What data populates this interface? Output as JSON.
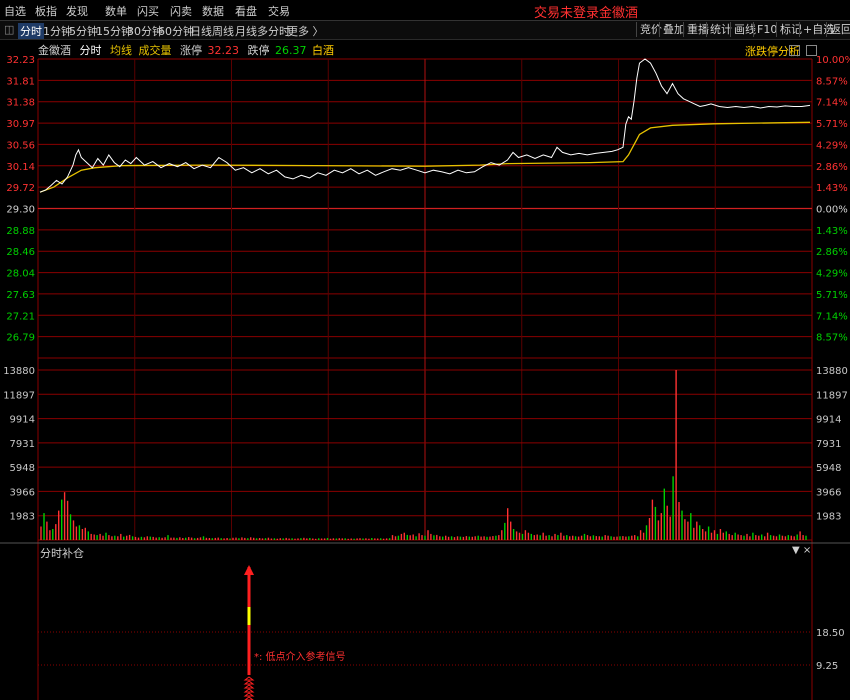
{
  "menu": {
    "items": [
      "自选",
      "板指",
      "发现",
      "数单",
      "闪买",
      "闪卖",
      "数据",
      "看盘",
      "交易"
    ],
    "center_status": "交易未登录",
    "center_stock": "金徽酒"
  },
  "toolbar": {
    "periods": [
      "分时",
      "1分钟",
      "5分钟",
      "15分钟",
      "30分钟",
      "60分钟",
      "日线",
      "周线",
      "月线",
      "多分时",
      "更多 〉"
    ],
    "active": "分时",
    "right_buttons": [
      "竞价",
      "叠加",
      "重播",
      "统计",
      "画线",
      "F10",
      "标记",
      "+自选",
      "返回"
    ]
  },
  "chart_header": {
    "stock": "金徽酒",
    "mode": "分时",
    "avg_label": "均线",
    "vol_label": "成交量",
    "limit_up_label": "涨停",
    "limit_up_value": "32.23",
    "limit_down_label": "跌停",
    "limit_down_value": "26.37",
    "theme_label": "白酒",
    "analysis_link": "涨跌停分析"
  },
  "price_axis": {
    "left": [
      "32.23",
      "31.81",
      "31.38",
      "30.97",
      "30.56",
      "30.14",
      "29.72",
      "29.30",
      "28.88",
      "28.46",
      "28.04",
      "27.63",
      "27.21",
      "26.79"
    ],
    "right": [
      "10.00%",
      "8.57%",
      "7.14%",
      "5.71%",
      "4.29%",
      "2.86%",
      "1.43%",
      "0.00%",
      "1.43%",
      "2.86%",
      "4.29%",
      "5.71%",
      "7.14%",
      "8.57%"
    ]
  },
  "volume_axis": [
    "13880",
    "11897",
    "9914",
    "7931",
    "5948",
    "3966",
    "1983"
  ],
  "sub_panel": {
    "title": "分时补仓",
    "controls": "▼  ×",
    "y_labels": [
      "18.50",
      "9.25"
    ],
    "signal_text": "*: 低点介入参考信号"
  },
  "colors": {
    "up": "#ff3232",
    "down": "#00d000",
    "grid": "#8a0000",
    "price_line": "#ffffff",
    "avg_line": "#e6c200",
    "signal_yellow": "#ffff00"
  },
  "chart_data": {
    "type": "line",
    "prev_close": 29.3,
    "ylim": [
      26.37,
      32.23
    ],
    "minutes": 240,
    "price_series_name": "分时",
    "avg_series_name": "均线",
    "price": [
      [
        0,
        29.62
      ],
      [
        2,
        29.66
      ],
      [
        4,
        29.75
      ],
      [
        6,
        29.85
      ],
      [
        8,
        29.78
      ],
      [
        10,
        29.92
      ],
      [
        12,
        30.15
      ],
      [
        13,
        30.35
      ],
      [
        14,
        30.45
      ],
      [
        15,
        30.3
      ],
      [
        17,
        30.2
      ],
      [
        19,
        30.1
      ],
      [
        21,
        30.28
      ],
      [
        23,
        30.15
      ],
      [
        25,
        30.35
      ],
      [
        27,
        30.2
      ],
      [
        29,
        30.12
      ],
      [
        31,
        30.25
      ],
      [
        33,
        30.18
      ],
      [
        35,
        30.3
      ],
      [
        38,
        30.15
      ],
      [
        41,
        30.22
      ],
      [
        44,
        30.1
      ],
      [
        47,
        30.18
      ],
      [
        50,
        30.12
      ],
      [
        53,
        30.2
      ],
      [
        56,
        30.08
      ],
      [
        59,
        30.15
      ],
      [
        62,
        30.1
      ],
      [
        65,
        30.3
      ],
      [
        68,
        30.2
      ],
      [
        71,
        30.05
      ],
      [
        74,
        30.1
      ],
      [
        77,
        30.0
      ],
      [
        80,
        30.08
      ],
      [
        83,
        29.98
      ],
      [
        86,
        30.05
      ],
      [
        89,
        29.92
      ],
      [
        92,
        29.88
      ],
      [
        95,
        29.95
      ],
      [
        98,
        29.9
      ],
      [
        101,
        30.0
      ],
      [
        104,
        29.95
      ],
      [
        107,
        30.05
      ],
      [
        110,
        30.0
      ],
      [
        113,
        30.08
      ],
      [
        116,
        29.98
      ],
      [
        119,
        30.05
      ],
      [
        122,
        29.95
      ],
      [
        125,
        30.02
      ],
      [
        128,
        30.08
      ],
      [
        131,
        30.05
      ],
      [
        134,
        30.1
      ],
      [
        137,
        30.05
      ],
      [
        140,
        30.0
      ],
      [
        143,
        30.05
      ],
      [
        146,
        30.02
      ],
      [
        149,
        29.98
      ],
      [
        152,
        30.05
      ],
      [
        155,
        30.0
      ],
      [
        158,
        30.02
      ],
      [
        161,
        30.12
      ],
      [
        164,
        30.2
      ],
      [
        167,
        30.15
      ],
      [
        170,
        30.25
      ],
      [
        172,
        30.4
      ],
      [
        174,
        30.3
      ],
      [
        177,
        30.35
      ],
      [
        180,
        30.28
      ],
      [
        183,
        30.35
      ],
      [
        186,
        30.3
      ],
      [
        188,
        30.5
      ],
      [
        190,
        30.4
      ],
      [
        193,
        30.35
      ],
      [
        196,
        30.38
      ],
      [
        199,
        30.35
      ],
      [
        202,
        30.38
      ],
      [
        205,
        30.4
      ],
      [
        208,
        30.42
      ],
      [
        210,
        30.45
      ],
      [
        212,
        30.5
      ],
      [
        213,
        30.95
      ],
      [
        214,
        31.1
      ],
      [
        215,
        31.05
      ],
      [
        216,
        31.4
      ],
      [
        217,
        31.85
      ],
      [
        218,
        32.15
      ],
      [
        220,
        32.23
      ],
      [
        222,
        32.15
      ],
      [
        224,
        31.95
      ],
      [
        226,
        31.7
      ],
      [
        228,
        31.55
      ],
      [
        230,
        31.75
      ],
      [
        232,
        31.55
      ],
      [
        234,
        31.45
      ],
      [
        236,
        31.4
      ],
      [
        238,
        31.35
      ],
      [
        240,
        31.3
      ],
      [
        242,
        31.32
      ],
      [
        244,
        31.35
      ],
      [
        247,
        31.3
      ],
      [
        250,
        31.28
      ],
      [
        253,
        31.3
      ],
      [
        256,
        31.28
      ],
      [
        259,
        31.3
      ],
      [
        262,
        31.27
      ],
      [
        265,
        31.3
      ],
      [
        268,
        31.29
      ],
      [
        271,
        31.31
      ],
      [
        274,
        31.3
      ],
      [
        277,
        31.3
      ],
      [
        280,
        31.32
      ]
    ],
    "avg": [
      [
        0,
        29.62
      ],
      [
        5,
        29.72
      ],
      [
        10,
        29.9
      ],
      [
        15,
        30.05
      ],
      [
        20,
        30.1
      ],
      [
        30,
        30.14
      ],
      [
        60,
        30.15
      ],
      [
        100,
        30.14
      ],
      [
        140,
        30.13
      ],
      [
        160,
        30.15
      ],
      [
        170,
        30.18
      ],
      [
        200,
        30.2
      ],
      [
        212,
        30.22
      ],
      [
        214,
        30.35
      ],
      [
        216,
        30.55
      ],
      [
        218,
        30.75
      ],
      [
        222,
        30.88
      ],
      [
        230,
        30.93
      ],
      [
        245,
        30.96
      ],
      [
        280,
        30.99
      ]
    ],
    "volume": [
      [
        0,
        1100
      ],
      [
        1,
        2200
      ],
      [
        2,
        1500
      ],
      [
        3,
        800
      ],
      [
        4,
        900
      ],
      [
        5,
        1300
      ],
      [
        6,
        2400
      ],
      [
        7,
        3300
      ],
      [
        8,
        3900
      ],
      [
        9,
        3200
      ],
      [
        10,
        2100
      ],
      [
        11,
        1600
      ],
      [
        12,
        1100
      ],
      [
        13,
        1200
      ],
      [
        14,
        900
      ],
      [
        15,
        1000
      ],
      [
        16,
        700
      ],
      [
        17,
        500
      ],
      [
        18,
        450
      ],
      [
        19,
        400
      ],
      [
        20,
        500
      ],
      [
        21,
        350
      ],
      [
        22,
        600
      ],
      [
        23,
        400
      ],
      [
        24,
        300
      ],
      [
        25,
        350
      ],
      [
        26,
        300
      ],
      [
        27,
        500
      ],
      [
        28,
        280
      ],
      [
        29,
        350
      ],
      [
        30,
        420
      ],
      [
        31,
        300
      ],
      [
        32,
        250
      ],
      [
        33,
        200
      ],
      [
        34,
        260
      ],
      [
        35,
        220
      ],
      [
        36,
        300
      ],
      [
        37,
        280
      ],
      [
        38,
        250
      ],
      [
        39,
        200
      ],
      [
        40,
        230
      ],
      [
        41,
        180
      ],
      [
        42,
        220
      ],
      [
        43,
        400
      ],
      [
        44,
        190
      ],
      [
        45,
        200
      ],
      [
        46,
        170
      ],
      [
        47,
        220
      ],
      [
        48,
        160
      ],
      [
        49,
        190
      ],
      [
        50,
        240
      ],
      [
        51,
        200
      ],
      [
        52,
        150
      ],
      [
        53,
        170
      ],
      [
        54,
        210
      ],
      [
        55,
        300
      ],
      [
        56,
        180
      ],
      [
        57,
        160
      ],
      [
        58,
        150
      ],
      [
        59,
        170
      ],
      [
        60,
        200
      ],
      [
        61,
        150
      ],
      [
        62,
        130
      ],
      [
        63,
        160
      ],
      [
        64,
        120
      ],
      [
        65,
        180
      ],
      [
        66,
        200
      ],
      [
        67,
        150
      ],
      [
        68,
        210
      ],
      [
        69,
        170
      ],
      [
        70,
        150
      ],
      [
        71,
        220
      ],
      [
        72,
        180
      ],
      [
        73,
        140
      ],
      [
        74,
        160
      ],
      [
        75,
        130
      ],
      [
        76,
        150
      ],
      [
        77,
        190
      ],
      [
        78,
        120
      ],
      [
        79,
        140
      ],
      [
        80,
        110
      ],
      [
        81,
        150
      ],
      [
        82,
        130
      ],
      [
        83,
        170
      ],
      [
        84,
        120
      ],
      [
        85,
        140
      ],
      [
        86,
        110
      ],
      [
        87,
        130
      ],
      [
        88,
        150
      ],
      [
        89,
        180
      ],
      [
        90,
        130
      ],
      [
        91,
        160
      ],
      [
        92,
        120
      ],
      [
        93,
        100
      ],
      [
        94,
        140
      ],
      [
        95,
        120
      ],
      [
        96,
        130
      ],
      [
        97,
        160
      ],
      [
        98,
        110
      ],
      [
        99,
        140
      ],
      [
        100,
        120
      ],
      [
        101,
        150
      ],
      [
        102,
        130
      ],
      [
        103,
        140
      ],
      [
        104,
        100
      ],
      [
        105,
        120
      ],
      [
        106,
        110
      ],
      [
        107,
        130
      ],
      [
        108,
        150
      ],
      [
        109,
        120
      ],
      [
        110,
        140
      ],
      [
        111,
        110
      ],
      [
        112,
        160
      ],
      [
        113,
        130
      ],
      [
        114,
        120
      ],
      [
        115,
        140
      ],
      [
        116,
        110
      ],
      [
        117,
        130
      ],
      [
        118,
        150
      ],
      [
        119,
        400
      ],
      [
        120,
        300
      ],
      [
        121,
        350
      ],
      [
        122,
        500
      ],
      [
        123,
        600
      ],
      [
        124,
        420
      ],
      [
        125,
        380
      ],
      [
        126,
        450
      ],
      [
        127,
        300
      ],
      [
        128,
        550
      ],
      [
        129,
        400
      ],
      [
        130,
        350
      ],
      [
        131,
        800
      ],
      [
        132,
        500
      ],
      [
        133,
        380
      ],
      [
        134,
        420
      ],
      [
        135,
        300
      ],
      [
        136,
        280
      ],
      [
        137,
        350
      ],
      [
        138,
        260
      ],
      [
        139,
        300
      ],
      [
        140,
        240
      ],
      [
        141,
        300
      ],
      [
        142,
        280
      ],
      [
        143,
        250
      ],
      [
        144,
        320
      ],
      [
        145,
        280
      ],
      [
        146,
        260
      ],
      [
        147,
        300
      ],
      [
        148,
        350
      ],
      [
        149,
        280
      ],
      [
        150,
        300
      ],
      [
        151,
        260
      ],
      [
        152,
        280
      ],
      [
        153,
        320
      ],
      [
        154,
        350
      ],
      [
        155,
        400
      ],
      [
        156,
        800
      ],
      [
        157,
        1400
      ],
      [
        158,
        2600
      ],
      [
        159,
        1500
      ],
      [
        160,
        900
      ],
      [
        161,
        700
      ],
      [
        162,
        600
      ],
      [
        163,
        500
      ],
      [
        164,
        800
      ],
      [
        165,
        600
      ],
      [
        166,
        500
      ],
      [
        167,
        400
      ],
      [
        168,
        450
      ],
      [
        169,
        380
      ],
      [
        170,
        600
      ],
      [
        171,
        350
      ],
      [
        172,
        400
      ],
      [
        173,
        300
      ],
      [
        174,
        500
      ],
      [
        175,
        400
      ],
      [
        176,
        600
      ],
      [
        177,
        350
      ],
      [
        178,
        400
      ],
      [
        179,
        300
      ],
      [
        180,
        350
      ],
      [
        181,
        300
      ],
      [
        182,
        280
      ],
      [
        183,
        350
      ],
      [
        184,
        500
      ],
      [
        185,
        400
      ],
      [
        186,
        300
      ],
      [
        187,
        380
      ],
      [
        188,
        320
      ],
      [
        189,
        300
      ],
      [
        190,
        280
      ],
      [
        191,
        400
      ],
      [
        192,
        350
      ],
      [
        193,
        300
      ],
      [
        194,
        260
      ],
      [
        195,
        280
      ],
      [
        196,
        300
      ],
      [
        197,
        320
      ],
      [
        198,
        280
      ],
      [
        199,
        300
      ],
      [
        200,
        350
      ],
      [
        201,
        400
      ],
      [
        202,
        300
      ],
      [
        203,
        800
      ],
      [
        204,
        600
      ],
      [
        205,
        1200
      ],
      [
        206,
        1800
      ],
      [
        207,
        3300
      ],
      [
        208,
        2700
      ],
      [
        209,
        1600
      ],
      [
        210,
        2200
      ],
      [
        211,
        4200
      ],
      [
        212,
        2800
      ],
      [
        213,
        1900
      ],
      [
        214,
        5200
      ],
      [
        215,
        13880
      ],
      [
        216,
        3100
      ],
      [
        217,
        2400
      ],
      [
        218,
        1700
      ],
      [
        219,
        1500
      ],
      [
        220,
        2200
      ],
      [
        221,
        1000
      ],
      [
        222,
        1500
      ],
      [
        223,
        1200
      ],
      [
        224,
        900
      ],
      [
        225,
        700
      ],
      [
        226,
        1100
      ],
      [
        227,
        600
      ],
      [
        228,
        800
      ],
      [
        229,
        500
      ],
      [
        230,
        900
      ],
      [
        231,
        600
      ],
      [
        232,
        700
      ],
      [
        233,
        500
      ],
      [
        234,
        400
      ],
      [
        235,
        600
      ],
      [
        236,
        450
      ],
      [
        237,
        400
      ],
      [
        238,
        350
      ],
      [
        239,
        500
      ],
      [
        240,
        300
      ],
      [
        241,
        600
      ],
      [
        242,
        400
      ],
      [
        243,
        350
      ],
      [
        244,
        450
      ],
      [
        245,
        300
      ],
      [
        246,
        600
      ],
      [
        247,
        400
      ],
      [
        248,
        350
      ],
      [
        249,
        300
      ],
      [
        250,
        450
      ],
      [
        251,
        350
      ],
      [
        252,
        300
      ],
      [
        253,
        400
      ],
      [
        254,
        350
      ],
      [
        255,
        300
      ],
      [
        256,
        450
      ],
      [
        257,
        700
      ],
      [
        258,
        400
      ],
      [
        259,
        350
      ]
    ]
  }
}
